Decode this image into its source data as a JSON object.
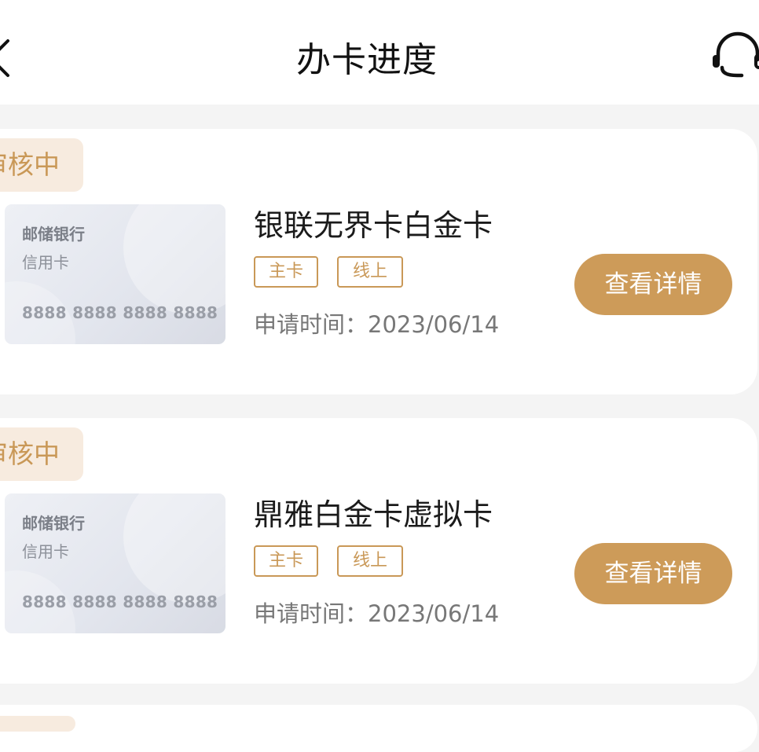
{
  "header": {
    "title": "办卡进度",
    "back_icon": "back-chevron-icon",
    "service_icon": "headset-icon"
  },
  "applications": [
    {
      "status": "审核中",
      "card_image": {
        "bank": "邮储银行",
        "kind": "信用卡",
        "number": "8888 8888 8888 8888"
      },
      "product_name": "银联无界卡白金卡",
      "tags": [
        "主卡",
        "线上"
      ],
      "apply_time_label": "申请时间：",
      "apply_time_value": "2023/06/14",
      "detail_button": "查看详情"
    },
    {
      "status": "审核中",
      "card_image": {
        "bank": "邮储银行",
        "kind": "信用卡",
        "number": "8888 8888 8888 8888"
      },
      "product_name": "鼎雅白金卡虚拟卡",
      "tags": [
        "主卡",
        "线上"
      ],
      "apply_time_label": "申请时间：",
      "apply_time_value": "2023/06/14",
      "detail_button": "查看详情"
    }
  ],
  "colors": {
    "accent": "#cd9b59",
    "badge_bg": "#f7ebdf",
    "page_bg": "#f4f4f4"
  }
}
